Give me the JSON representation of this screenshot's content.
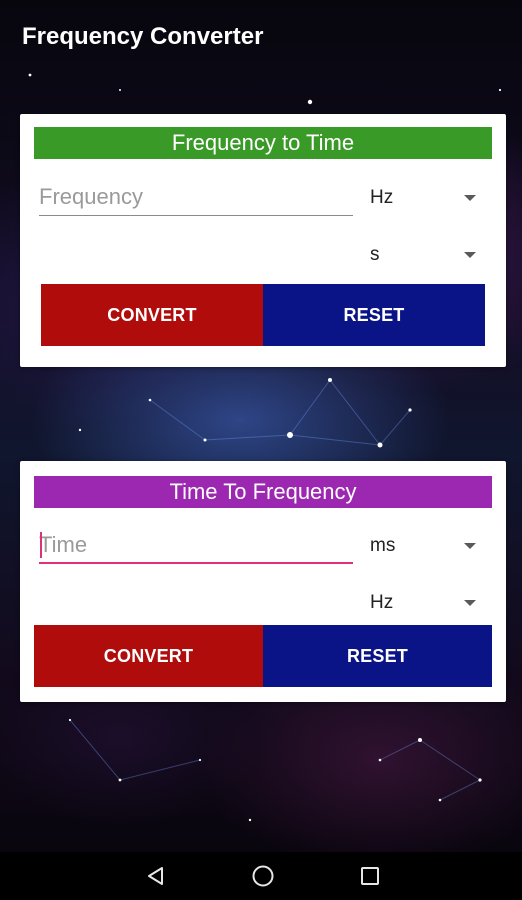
{
  "app": {
    "title": "Frequency Converter"
  },
  "freq_to_time": {
    "header": "Frequency to Time",
    "header_color": "#3a9a28",
    "input_placeholder": "Frequency",
    "input_value": "",
    "from_unit": "Hz",
    "to_unit": "s",
    "convert_label": "CONVERT",
    "reset_label": "RESET"
  },
  "time_to_freq": {
    "header": "Time To Frequency",
    "header_color": "#9c27b0",
    "input_placeholder": "Time",
    "input_value": "",
    "from_unit": "ms",
    "to_unit": "Hz",
    "convert_label": "CONVERT",
    "reset_label": "RESET"
  },
  "colors": {
    "convert_button": "#b00c0c",
    "reset_button": "#0a1486",
    "focus_underline": "#e0307a"
  },
  "navigation": {
    "back": "back-icon",
    "home": "home-icon",
    "recents": "recents-icon"
  }
}
